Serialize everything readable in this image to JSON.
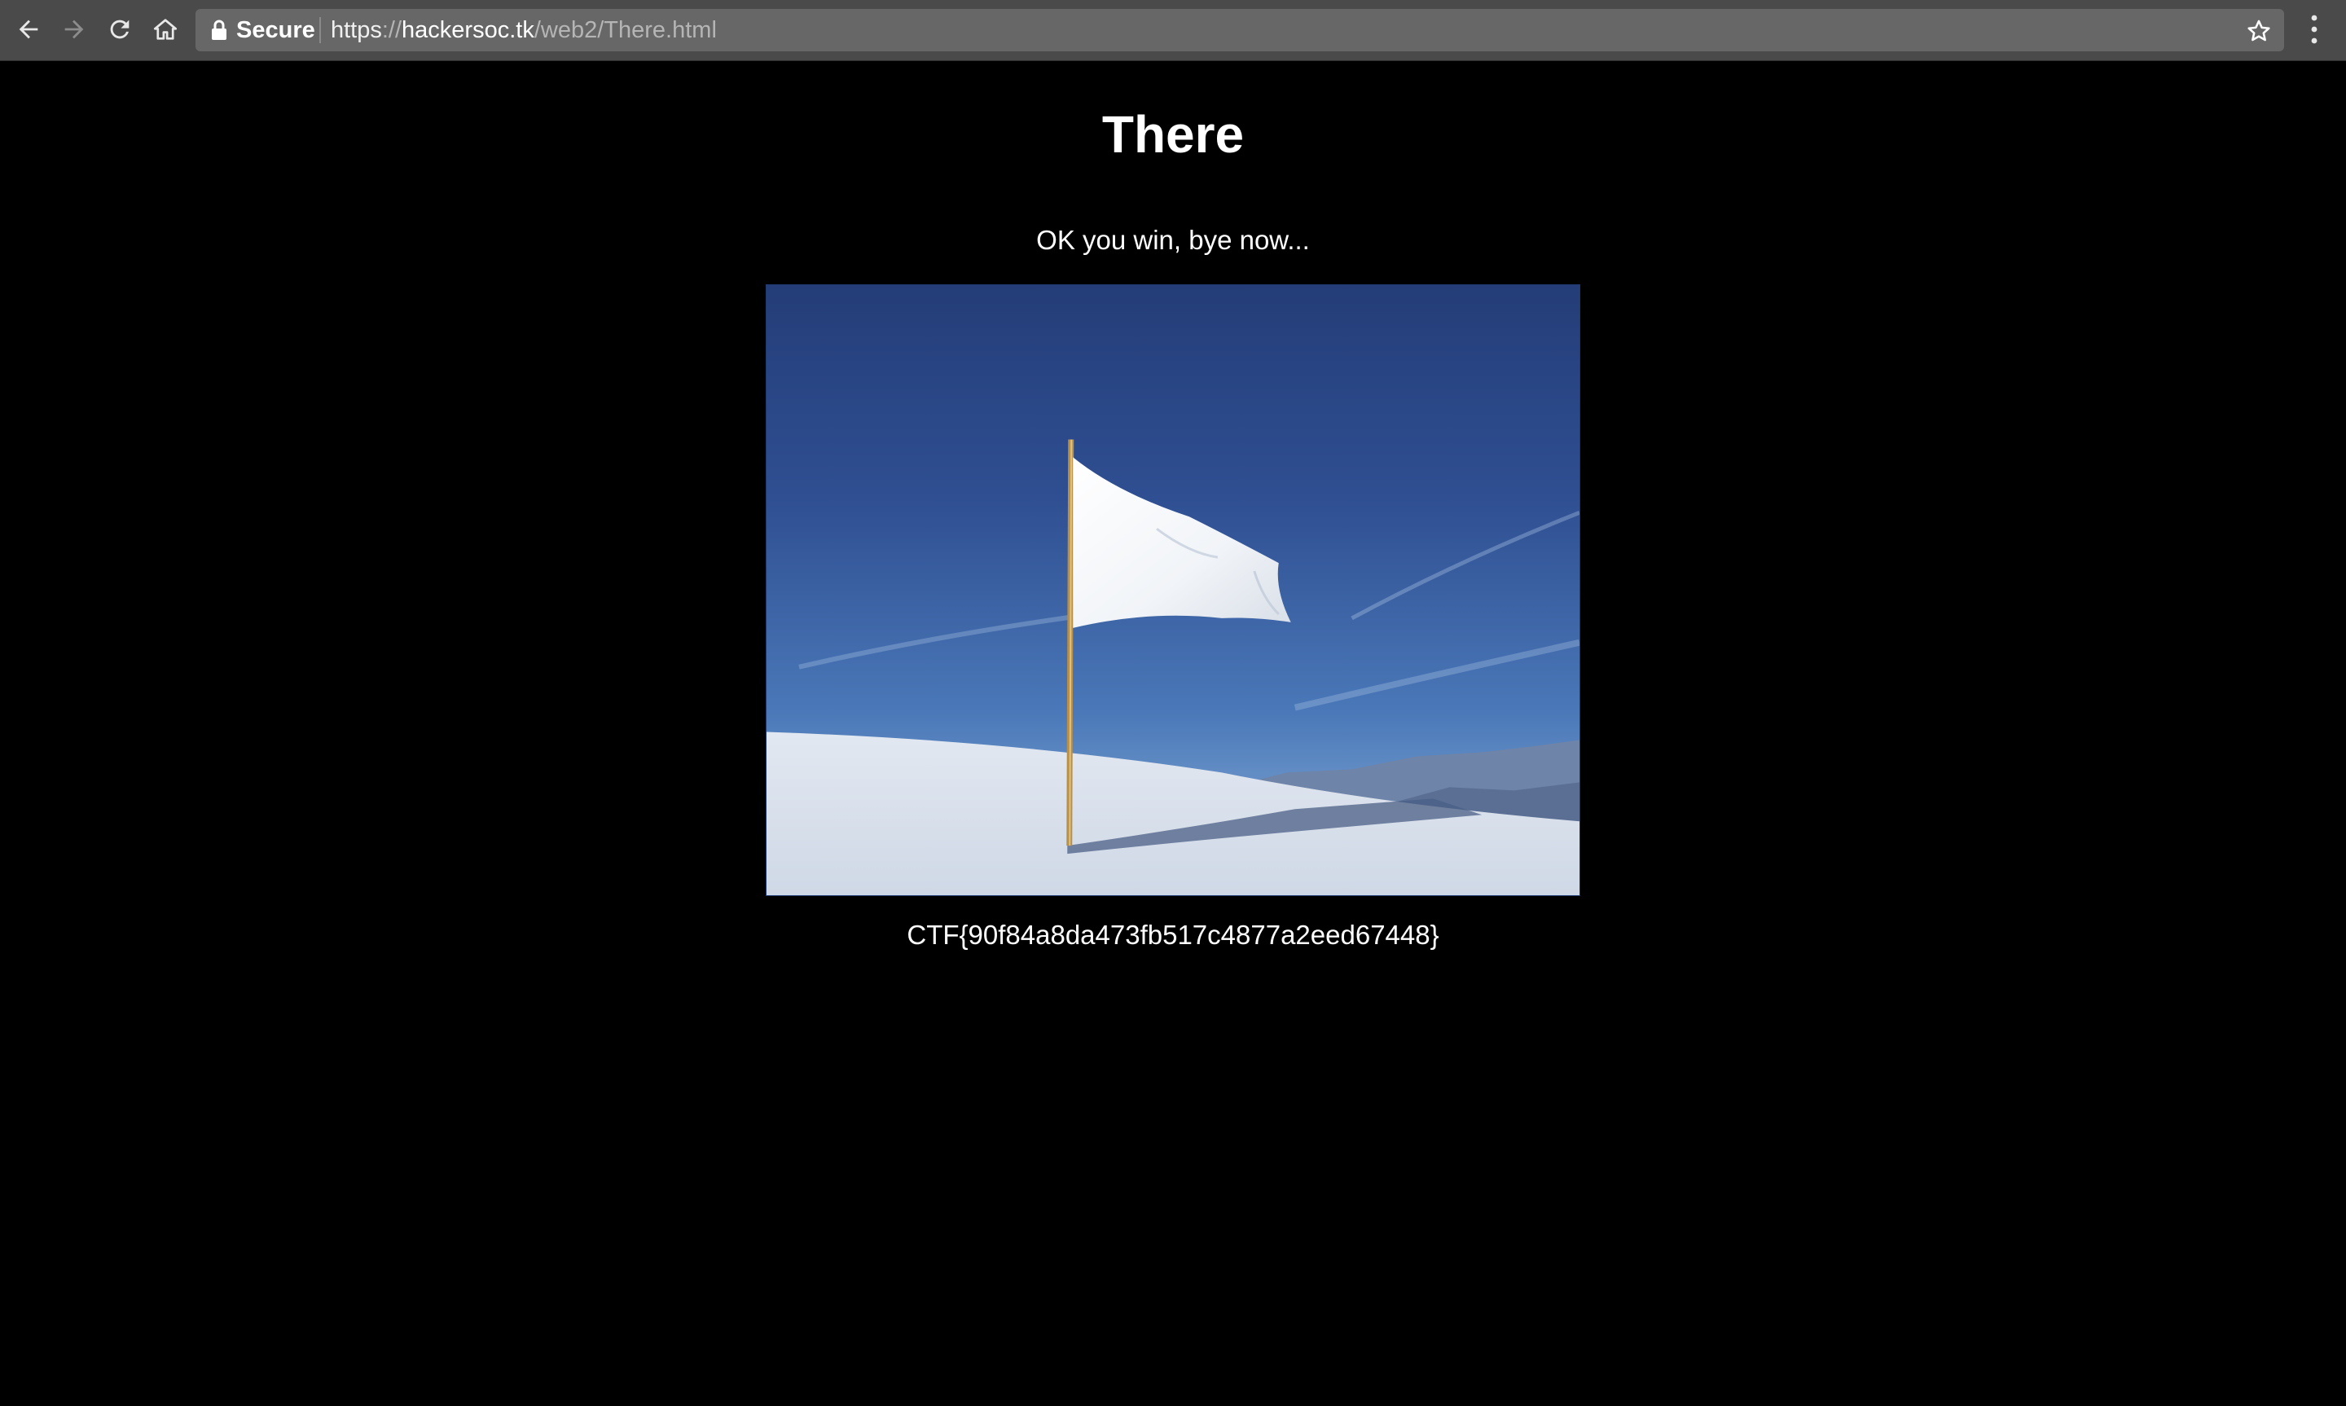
{
  "browser": {
    "security_label": "Secure",
    "url": {
      "scheme": "https",
      "separator": "://",
      "host": "hackersoc.tk",
      "path": "/web2/There.html"
    },
    "icons": {
      "back": "back-arrow-icon",
      "forward": "forward-arrow-icon",
      "reload": "reload-icon",
      "home": "home-icon",
      "lock": "lock-icon",
      "bookmark": "star-icon",
      "menu": "vertical-dots-icon"
    }
  },
  "page": {
    "title": "There",
    "message": "OK you win, bye now...",
    "image": {
      "subject": "white-flag-photo"
    },
    "flag": "CTF{90f84a8da473fb517c4877a2eed67448}"
  },
  "colors": {
    "page_background": "#000000",
    "text": "#ffffff",
    "toolbar": "#4a4a4a",
    "omnibox": "#676767"
  }
}
